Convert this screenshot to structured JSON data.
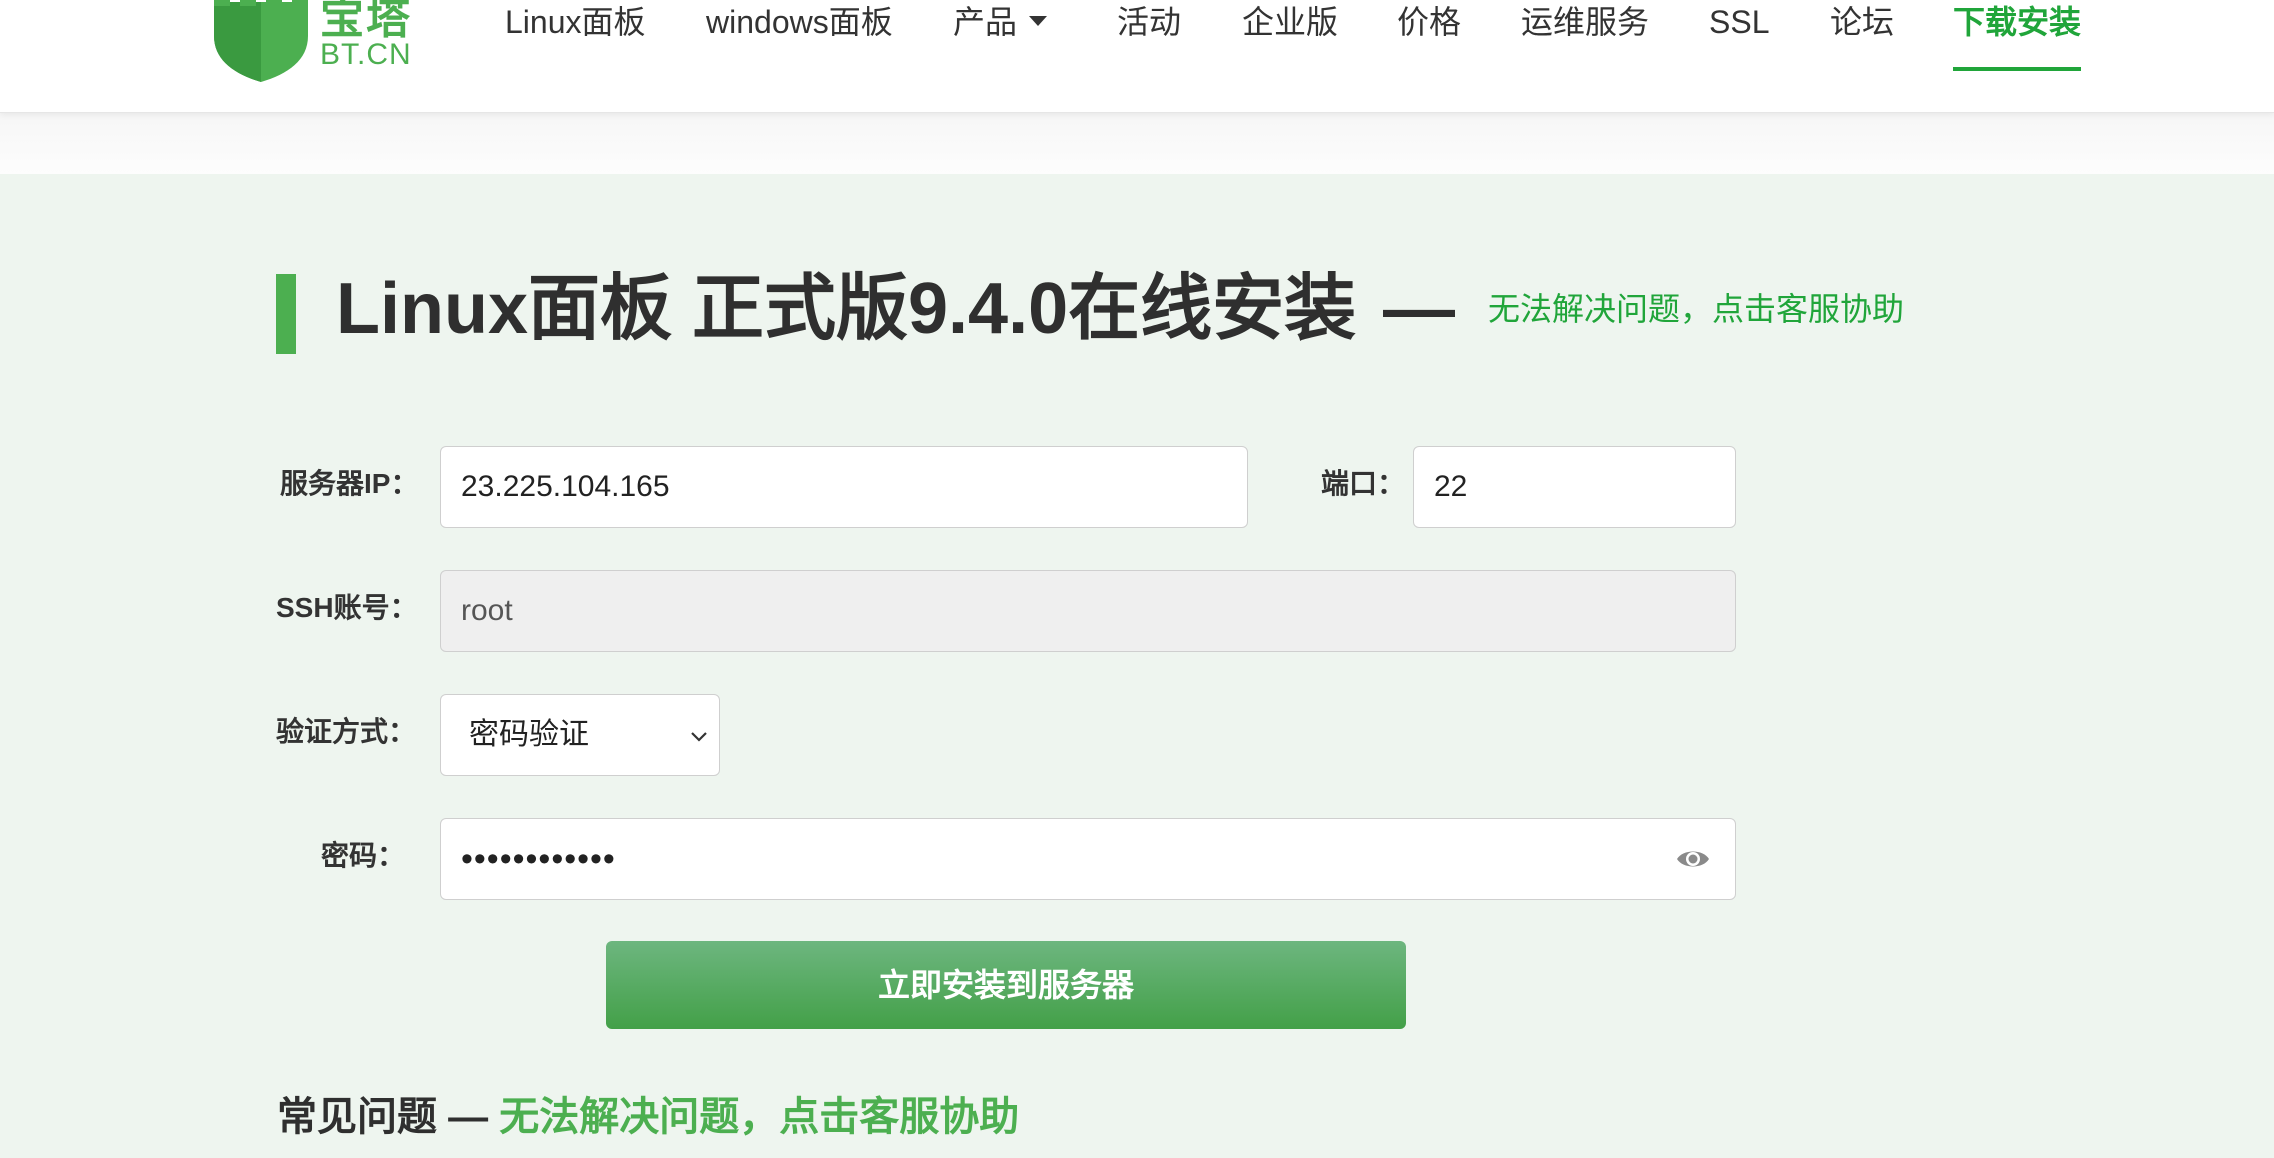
{
  "header": {
    "logo": {
      "cn_text": "宝塔",
      "en_text": "BT.CN",
      "brand_color": "#4caf50",
      "icon": "castle-shield-icon"
    },
    "nav": [
      {
        "label": "Linux面板"
      },
      {
        "label": "windows面板"
      },
      {
        "label": "产品",
        "has_dropdown": true
      },
      {
        "label": "活动"
      },
      {
        "label": "企业版"
      },
      {
        "label": "价格"
      },
      {
        "label": "运维服务"
      },
      {
        "label": "SSL"
      },
      {
        "label": "论坛"
      },
      {
        "label": "下载安装",
        "active": true
      }
    ],
    "active_color": "#20a53a"
  },
  "main": {
    "title": "Linux面板 正式版9.4.0在线安装",
    "title_dash": "—",
    "help_link": "无法解决问题，点击客服协助",
    "form": {
      "server_ip_label": "服务器IP：",
      "server_ip_value": "23.225.104.165",
      "port_label": "端口：",
      "port_value": "22",
      "ssh_label": "SSH账号：",
      "ssh_value": "root",
      "auth_label": "验证方式：",
      "auth_selected": "密码验证",
      "password_label": "密码：",
      "password_mask": "••••••••••••",
      "eye_icon": "eye-icon"
    },
    "install_button": "立即安装到服务器",
    "faq_title": "常见问题",
    "faq_dash": "—",
    "faq_link": "无法解决问题，点击客服协助",
    "background_color": "#eef5ef"
  }
}
